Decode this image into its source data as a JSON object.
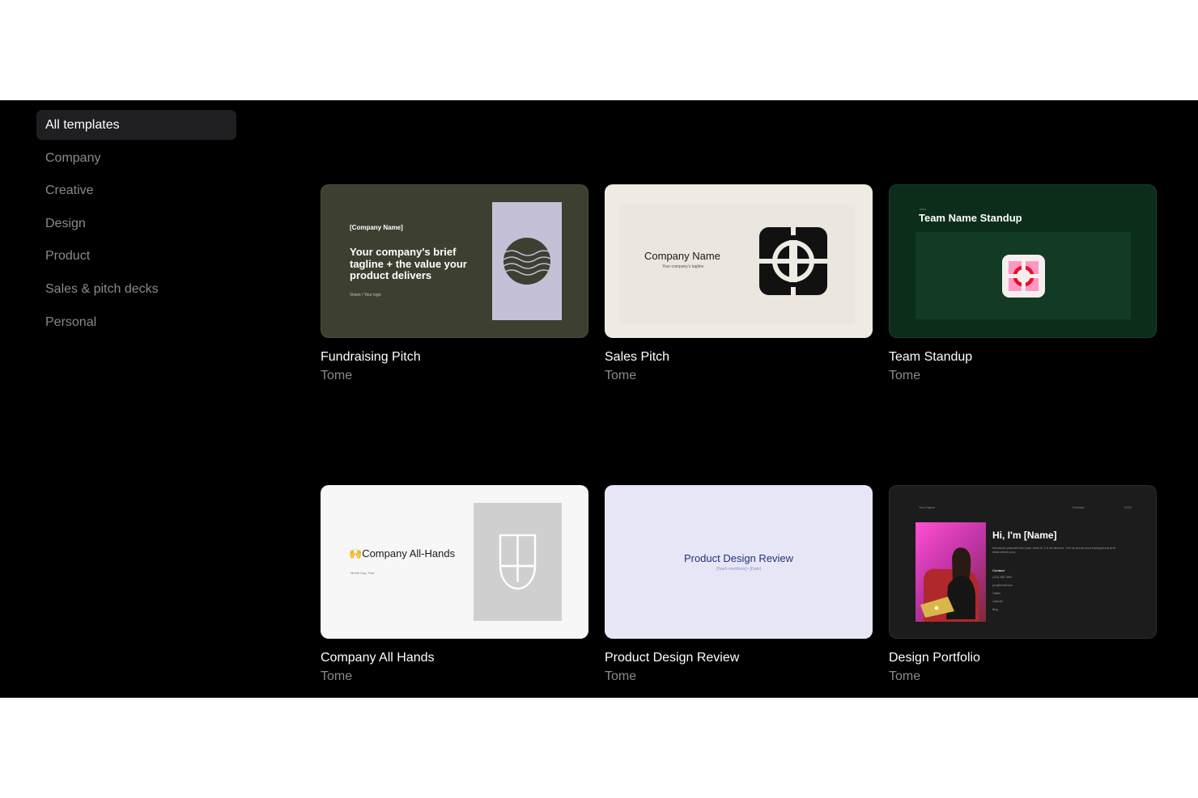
{
  "sidebar": {
    "items": [
      {
        "label": "All templates",
        "active": true
      },
      {
        "label": "Company"
      },
      {
        "label": "Creative"
      },
      {
        "label": "Design"
      },
      {
        "label": "Product"
      },
      {
        "label": "Sales & pitch decks"
      },
      {
        "label": "Personal"
      }
    ]
  },
  "cards": [
    {
      "title": "Fundraising Pitch",
      "author": "Tome",
      "thumb": {
        "company": "[Company Name]",
        "tagline": "Your company's brief tagline + the value your product delivers",
        "small": "Vision / Your logo"
      }
    },
    {
      "title": "Sales Pitch",
      "author": "Tome",
      "thumb": {
        "name": "Company Name",
        "tagline": "Your company's tagline"
      }
    },
    {
      "title": "Team Standup",
      "author": "Tome",
      "thumb": {
        "tiny": "Intro",
        "title": "Team Name Standup"
      }
    },
    {
      "title": "Company All Hands",
      "author": "Tome",
      "thumb": {
        "emoji": "🙌",
        "title": "Company All-Hands",
        "small": "Month Day, Year"
      }
    },
    {
      "title": "Product Design Review",
      "author": "Tome",
      "thumb": {
        "title": "Product Design Review",
        "small": "[Team members] • [Date]"
      }
    },
    {
      "title": "Design Portfolio",
      "author": "Tome",
      "thumb": {
        "nav_left": "Your Name",
        "nav_mid": "Portfolio",
        "nav_right": "2023",
        "title": "Hi, I'm [Name]",
        "desc": "Introduce yourself and your work in 2-3 sentences. Tell us about your background and what drives you.",
        "contact": "Contact",
        "lines": [
          "(123) 456-7890",
          "you@email.com",
          "Twitter",
          "LinkedIn",
          "Blog"
        ]
      }
    }
  ],
  "colors": {
    "app_bg": "#000000",
    "sidebar_active_bg": "#1f1f22",
    "muted_text": "#8a8a8a"
  }
}
